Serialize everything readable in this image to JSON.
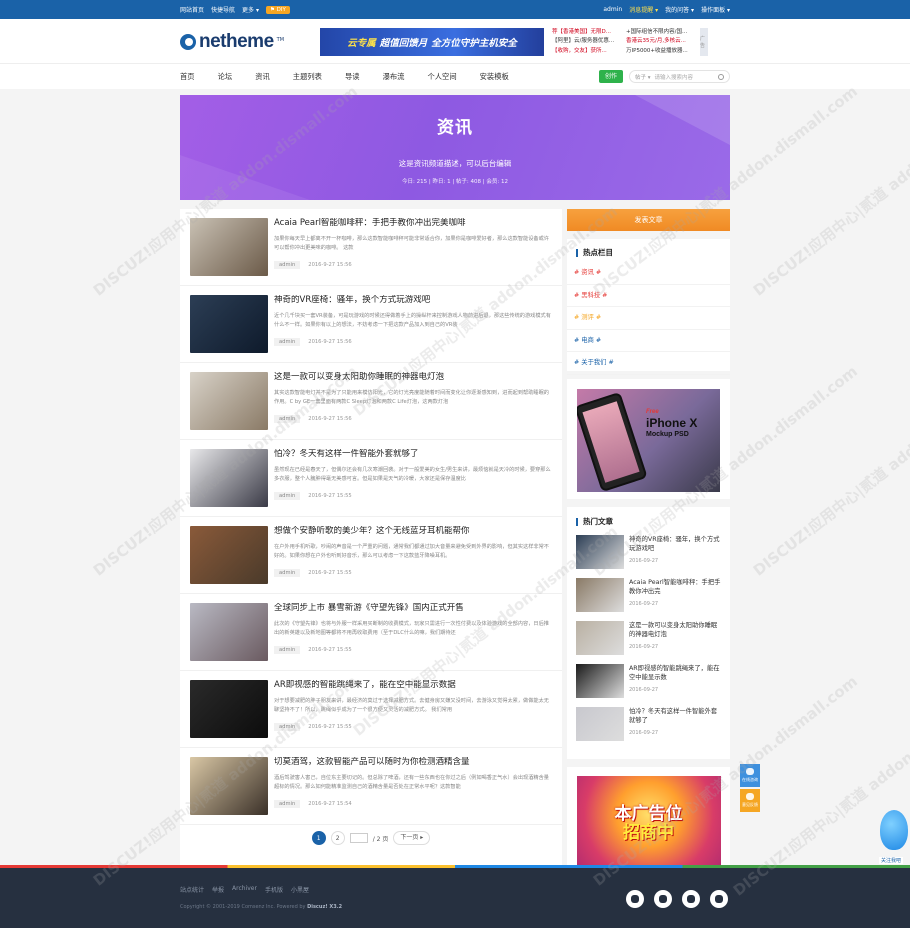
{
  "topbar": {
    "links": [
      "网站首页",
      "快捷导航",
      "更多"
    ],
    "diy": "DIY",
    "user": "admin",
    "notice": "消息提醒",
    "mine": "我的问答",
    "panel": "操作面板"
  },
  "header": {
    "logo": "netheme",
    "logo_tm": "TM",
    "banner_a": "云专属",
    "banner_b": "超值回馈月",
    "banner_c": "全方位守护主机安全",
    "ads": [
      {
        "text": "荐【香港美国】无限D...",
        "accent": true
      },
      {
        "text": "+国际组信不限内容/国...",
        "accent": false
      },
      {
        "text": "【阿里】云/服务器优惠...",
        "accent": false
      },
      {
        "text": "香港云35元/月,多核云...",
        "accent": true
      },
      {
        "text": "【收购，交友】获所...",
        "accent": true
      },
      {
        "text": "万IP5000+收益播放器...",
        "accent": false
      }
    ],
    "ad_side": "广告"
  },
  "nav": {
    "items": [
      "首页",
      "论坛",
      "资讯",
      "主题列表",
      "导读",
      "瀑布流",
      "个人空间",
      "安装模板"
    ],
    "post_button": "创作",
    "search_type": "帖子",
    "search_placeholder": "请输入搜索内容"
  },
  "hero": {
    "title": "资讯",
    "desc": "这是资讯频道描述，可以后台编辑",
    "stats": "今日: 215  |  昨日: 1  |  帖子: 408  |  会员: 12"
  },
  "articles": [
    {
      "title": "Acaia Pearl智能咖啡秤：手把手教你冲出完美咖啡",
      "summary": "加果你每天早上都离不开一杯咖啡，那么这款智能咖啡秤可能非常适合你，加果你是咖啡爱好者，那么这款智能设备或许可以帮你冲出更美味的咖啡。  这款",
      "author": "admin",
      "date": "2016-9-27 15:56",
      "thumb": [
        "#c9c1b4",
        "#6b5a48"
      ]
    },
    {
      "title": "神奇的VR座椅：骚年，换个方式玩游戏吧",
      "summary": "近个几千块买一套VR装备，可是玩游戏的时候还得做着手上的操纵杆来控制游戏人物前进后退，那这些传统的游戏模式有什么不一样。如果你有以上的想法，不妨考虑一下把这款产品加入到自己的VR装",
      "author": "admin",
      "date": "2016-9-27 15:56",
      "thumb": [
        "#2c3e55",
        "#0e1a2b"
      ]
    },
    {
      "title": "这是一款可以变身太阳助你睡眠的神器电灯泡",
      "summary": "其实这款智能电灯并不是为了只能用来模仿阳光，它的灯光亮度能随着时间而变化让你逐渐感知到，进而起到帮助睡眠的作用。C by GE一套里面有两款C Sleep灯泡和两款C Life灯泡，这两款灯泡",
      "author": "admin",
      "date": "2016-9-27 15:56",
      "thumb": [
        "#d8d2c8",
        "#8a7a66"
      ]
    },
    {
      "title": "怕冷？冬天有这样一件智能外套就够了",
      "summary": "虽然现在已经是春天了，但偶尔还会有几次寒潮回袭。对于一般爱美的女生/男生来讲，最烦恼就是天冷的时候，要穿那么多衣服，整个人臃肿得毫无美感可言。但是如果是天气的冷暖，大家还是保存温度比",
      "author": "admin",
      "date": "2016-9-27 15:55",
      "thumb": [
        "#e8e8ea",
        "#3a3a46"
      ]
    },
    {
      "title": "想做个安静听歌的美少年？这个无线蓝牙耳机能帮你",
      "summary": "在户外用手机听歌，吵闹的声音是一个严重的问题，通常我们都通过加大音量来避免受到外界的影响，但其实这样非常不好的。如果你想在户外也听到好音乐，那么可以考虑一下这款蓝牙降噪耳机。",
      "author": "admin",
      "date": "2016-9-27 15:55",
      "thumb": [
        "#8a5a3a",
        "#4a3a2a"
      ]
    },
    {
      "title": "全球同步上市 暴雪新游《守望先锋》国内正式开售",
      "summary": "此次的《守望先锋》也将与外服一样采用买断制的收费模式，玩家只需进行一次性付费以及体验游戏的全部内容，日后推出的新英雄以及新地图等都将不用再收取费用（至于DLC什么的嘛，我们期待还",
      "author": "admin",
      "date": "2016-9-27 15:55",
      "thumb": [
        "#b9b9c3",
        "#6a5a60"
      ]
    },
    {
      "title": "AR即视感的智能跳绳来了，能在空中能显示数据",
      "summary": "对于想要减肥的胖子朋友来讲，最经济的莫过于选择减肥方式。去健身房又嫌又没时间，去游泳又觉得太累，做做能太无聊坚持不了！所以，跳绳似乎成为了一个很方便又灵活的减肥方式。  我们常用",
      "author": "admin",
      "date": "2016-9-27 15:55",
      "thumb": [
        "#2a2a2a",
        "#0c0c0c"
      ]
    },
    {
      "title": "切莫酒驾，这款智能产品可以随时为你检测酒精含量",
      "summary": "酒后驾驶害人害己，自位东主要切记的。但总除了啤酒，还有一些东西也在你过之后（例如喝香正气水）会出现酒精含量超标的情况。那么如何能精准监测自己的酒精含量是否处在正常水平呢？这款智能",
      "author": "admin",
      "date": "2016-9-27 15:54",
      "thumb": [
        "#d9c7a5",
        "#3a3028"
      ]
    }
  ],
  "pager": {
    "current": "1",
    "second": "2",
    "total": "/ 2 页",
    "next": "下一页"
  },
  "sidebar": {
    "release": "发表文章",
    "hot_cat_title": "热点栏目",
    "categories": [
      {
        "label": "# 资讯 #",
        "color": "#e53935"
      },
      {
        "label": "# 黑科技 #",
        "color": "#e53935"
      },
      {
        "label": "# 测评 #",
        "color": "#f5a623"
      },
      {
        "label": "# 电商 #",
        "color": "#1a62a8"
      },
      {
        "label": "# 关于我们 #",
        "color": "#1a62a8"
      }
    ],
    "promo_brand": "Free",
    "promo_a": "iPhone X",
    "promo_b": "Mockup PSD",
    "hot_title": "热门文章",
    "hot": [
      {
        "title": "神奇的VR座椅：骚年，换个方式玩游戏吧",
        "date": "2016-09-27",
        "thumb": "#2c3e55"
      },
      {
        "title": "Acaia Pearl智能咖啡秤：手把手教你冲出完",
        "date": "2016-09-27",
        "thumb": "#8a7a66"
      },
      {
        "title": "这是一款可以变身太阳助你睡眠的神器电灯泡",
        "date": "2016-09-27",
        "thumb": "#b9b0a2"
      },
      {
        "title": "AR即视感的智能跳绳来了，能在空中能显示数",
        "date": "2016-09-27",
        "thumb": "#1a1a1a"
      },
      {
        "title": "怕冷？冬天有这样一件智能外套就够了",
        "date": "2016-09-27",
        "thumb": "#c8c8ce"
      }
    ],
    "ad_a": "本广告位",
    "ad_b": "招商中"
  },
  "float": {
    "consult": "在线咨询",
    "feedback": "意见反馈"
  },
  "mascot": "关注我吧",
  "footer": {
    "links": [
      "站点统计",
      "举报",
      "Archiver",
      "手机版",
      "小黑屋"
    ],
    "copyright": "Copyright © 2001-2019 Comsenz Inc.  Powered by",
    "powered": "Discuz! X3.2"
  },
  "watermark": "DISCUZ!应用中心|贰道 addon.dismall.com"
}
